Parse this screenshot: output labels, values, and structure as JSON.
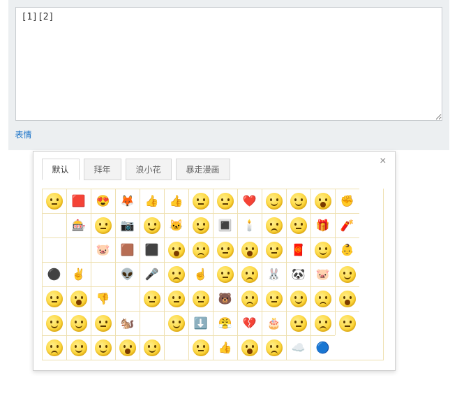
{
  "editor": {
    "value": "[1][2]",
    "emoji_link": "表情"
  },
  "popup": {
    "close": "×",
    "tabs": [
      {
        "label": "默认",
        "active": true
      },
      {
        "label": "拜年",
        "active": false
      },
      {
        "label": "浪小花",
        "active": false
      },
      {
        "label": "暴走漫画",
        "active": false
      }
    ],
    "grid": {
      "cols": 14,
      "items": [
        {
          "t": "face",
          "m": "flat",
          "n": "neutral"
        },
        {
          "t": "sq",
          "v": "🟥",
          "n": "red-square"
        },
        {
          "t": "sq",
          "v": "😍",
          "n": "heart-eyes"
        },
        {
          "t": "sq",
          "v": "🦊",
          "n": "fox"
        },
        {
          "t": "sq",
          "v": "👍",
          "n": "thumbs-up-pale"
        },
        {
          "t": "sq",
          "v": "👍",
          "n": "thumbs-up"
        },
        {
          "t": "face",
          "m": "flat",
          "c": "#d44",
          "n": "angry-red"
        },
        {
          "t": "face",
          "m": "flat",
          "n": "hmm"
        },
        {
          "t": "sq",
          "v": "❤️",
          "n": "heart"
        },
        {
          "t": "face",
          "m": "smile",
          "n": "smile-hand"
        },
        {
          "t": "face",
          "m": "smile",
          "n": "think"
        },
        {
          "t": "face",
          "m": "open",
          "n": "laugh-big"
        },
        {
          "t": "sq",
          "v": "✊",
          "n": "fist"
        },
        {
          "t": "sq",
          "v": "",
          "n": "blank"
        },
        {
          "t": "sq",
          "v": "🎰",
          "n": "slot"
        },
        {
          "t": "face",
          "m": "flat",
          "n": "closed-eyes"
        },
        {
          "t": "sq",
          "v": "📷",
          "n": "camera"
        },
        {
          "t": "face",
          "m": "smile",
          "n": "happy"
        },
        {
          "t": "sq",
          "v": "🐱",
          "n": "cat-blue"
        },
        {
          "t": "face",
          "m": "smile",
          "n": "quiet"
        },
        {
          "t": "sq",
          "v": "🔳",
          "n": "frame"
        },
        {
          "t": "sq",
          "v": "🕯️",
          "n": "candle"
        },
        {
          "t": "face",
          "m": "sad",
          "n": "worried"
        },
        {
          "t": "face",
          "m": "flat",
          "n": "sunglasses"
        },
        {
          "t": "sq",
          "v": "🎁",
          "n": "gift"
        },
        {
          "t": "sq",
          "v": "🧨",
          "n": "firecracker"
        },
        {
          "t": "sq",
          "v": "",
          "n": "blank"
        },
        {
          "t": "sq",
          "v": "",
          "n": "blank"
        },
        {
          "t": "sq",
          "v": "🐷",
          "n": "pig-toy"
        },
        {
          "t": "sq",
          "v": "🟫",
          "n": "brown-sq"
        },
        {
          "t": "sq",
          "v": "⬛",
          "n": "dark-sq"
        },
        {
          "t": "face",
          "m": "open",
          "n": "drool"
        },
        {
          "t": "face",
          "m": "sad",
          "n": "tired"
        },
        {
          "t": "face",
          "m": "flat",
          "n": "meh"
        },
        {
          "t": "face",
          "m": "open",
          "n": "shout"
        },
        {
          "t": "face",
          "m": "flat",
          "n": "smirk"
        },
        {
          "t": "sq",
          "v": "🧧",
          "n": "red-envelope"
        },
        {
          "t": "face",
          "m": "smile",
          "n": "relieved"
        },
        {
          "t": "sq",
          "v": "👶",
          "n": "baby"
        },
        {
          "t": "sq",
          "v": "⚫",
          "n": "black-ball"
        },
        {
          "t": "sq",
          "v": "✌️",
          "n": "peace-hand"
        },
        {
          "t": "sq",
          "v": "",
          "n": "blank"
        },
        {
          "t": "sq",
          "v": "👽",
          "n": "ultraman"
        },
        {
          "t": "sq",
          "v": "🎤",
          "n": "mic"
        },
        {
          "t": "face",
          "m": "sad",
          "n": "angry"
        },
        {
          "t": "sq",
          "v": "☝️",
          "n": "finger"
        },
        {
          "t": "face",
          "m": "flat",
          "n": "side-eye"
        },
        {
          "t": "face",
          "m": "sad",
          "n": "unhappy"
        },
        {
          "t": "sq",
          "v": "🐰",
          "n": "rabbit"
        },
        {
          "t": "sq",
          "v": "🐼",
          "n": "panda"
        },
        {
          "t": "sq",
          "v": "🐷",
          "n": "pig"
        },
        {
          "t": "face",
          "m": "smile",
          "n": "grin"
        },
        {
          "t": "face",
          "m": "flat",
          "n": "confused"
        },
        {
          "t": "face",
          "m": "open",
          "n": "cry-loud"
        },
        {
          "t": "sq",
          "v": "👎",
          "n": "thumbs-down"
        },
        {
          "t": "sq",
          "v": "",
          "n": "blank"
        },
        {
          "t": "face",
          "m": "flat",
          "c": "#5ad",
          "n": "sick"
        },
        {
          "t": "face",
          "m": "flat",
          "n": "bored"
        },
        {
          "t": "face",
          "m": "flat",
          "n": "plain"
        },
        {
          "t": "sq",
          "v": "🐻",
          "n": "bear"
        },
        {
          "t": "face",
          "m": "sad",
          "n": "sweat"
        },
        {
          "t": "face",
          "m": "flat",
          "n": "sleepy"
        },
        {
          "t": "face",
          "m": "smile",
          "n": "content"
        },
        {
          "t": "face",
          "m": "sad",
          "n": "pout"
        },
        {
          "t": "face",
          "m": "open",
          "n": "surprised"
        },
        {
          "t": "face",
          "m": "smile",
          "n": "pleased"
        },
        {
          "t": "face",
          "m": "smile",
          "n": "blush"
        },
        {
          "t": "face",
          "m": "flat",
          "n": "look"
        },
        {
          "t": "sq",
          "v": "🐿️",
          "n": "squirrel"
        },
        {
          "t": "sq",
          "v": "",
          "n": "blank"
        },
        {
          "t": "face",
          "m": "smile",
          "n": "wave"
        },
        {
          "t": "sq",
          "v": "⬇️",
          "n": "down-arrow"
        },
        {
          "t": "sq",
          "v": "😤",
          "n": "rage-comic"
        },
        {
          "t": "sq",
          "v": "💔",
          "n": "broken-heart"
        },
        {
          "t": "sq",
          "v": "🎂",
          "n": "cake"
        },
        {
          "t": "face",
          "m": "flat",
          "n": "shh"
        },
        {
          "t": "face",
          "m": "sad",
          "n": "dizzy"
        },
        {
          "t": "face",
          "m": "flat",
          "n": "whistle"
        },
        {
          "t": "face",
          "m": "sad",
          "n": "sniff"
        },
        {
          "t": "face",
          "m": "smile",
          "n": "victory"
        },
        {
          "t": "face",
          "m": "smile",
          "n": "hehe"
        },
        {
          "t": "face",
          "m": "open",
          "n": "haha"
        },
        {
          "t": "face",
          "m": "smile",
          "n": "giggle"
        },
        {
          "t": "sq",
          "v": "",
          "n": "blank"
        },
        {
          "t": "face",
          "m": "flat",
          "n": "glance"
        },
        {
          "t": "sq",
          "v": "👍",
          "n": "thumb-yellow"
        },
        {
          "t": "face",
          "m": "open",
          "n": "scared"
        },
        {
          "t": "face",
          "m": "sad",
          "n": "tear"
        },
        {
          "t": "sq",
          "v": "☁️",
          "n": "cloud"
        },
        {
          "t": "sq",
          "v": "🔵",
          "n": "ma-icon"
        }
      ]
    }
  }
}
